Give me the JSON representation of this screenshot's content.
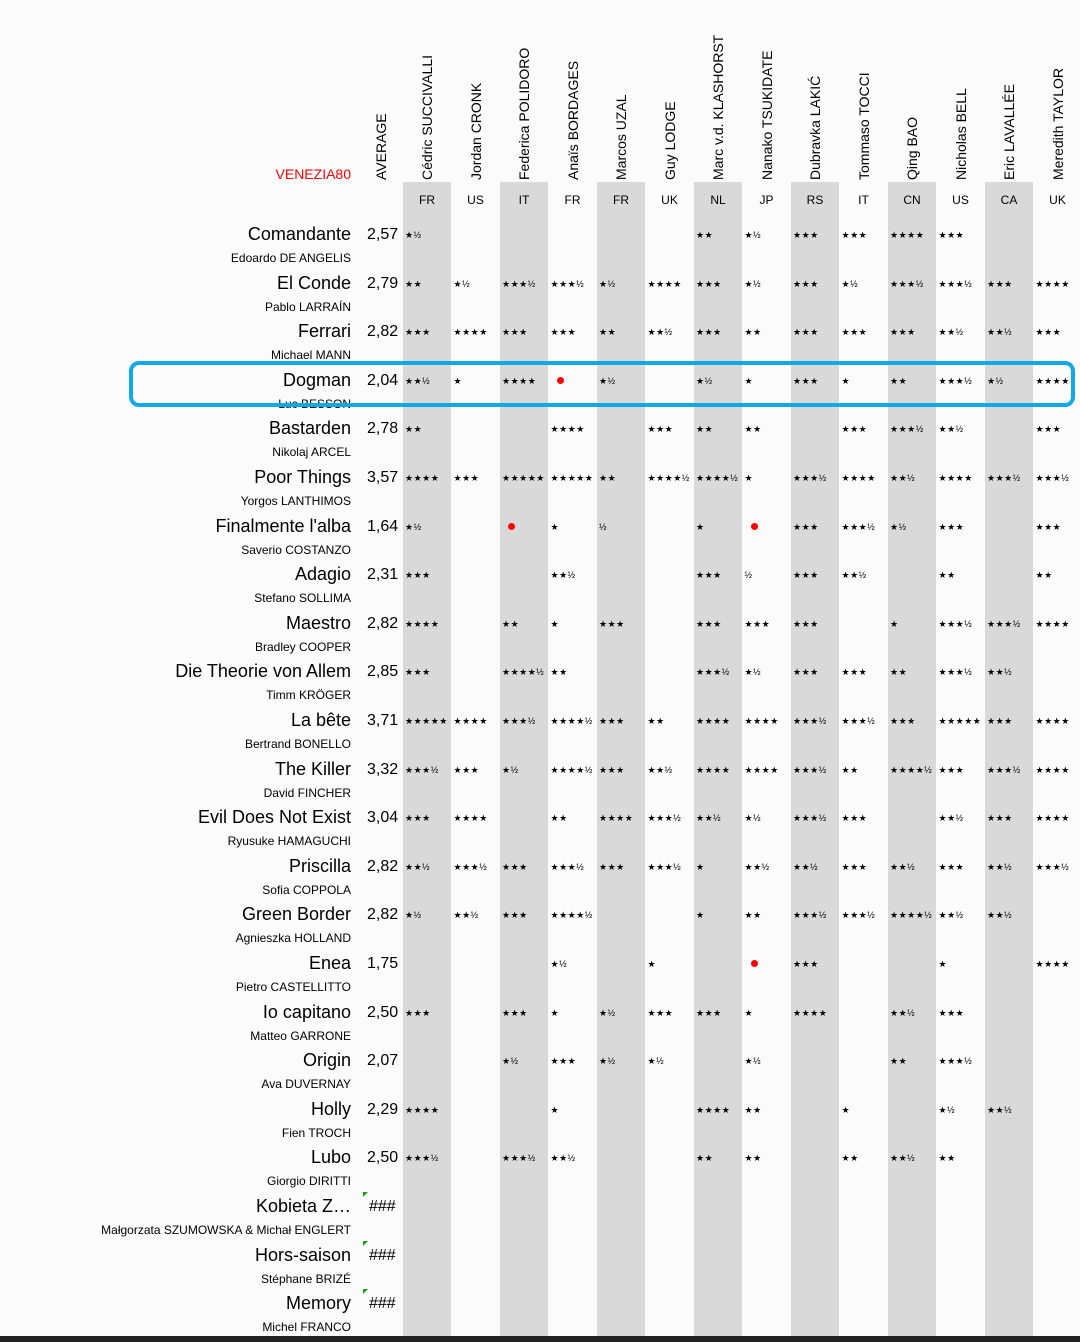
{
  "brand": "VENEZIA80",
  "average_header": "AVERAGE",
  "critics": [
    {
      "name": "Cédric SUCCIVALLI",
      "country": "FR"
    },
    {
      "name": "Jordan CRONK",
      "country": "US"
    },
    {
      "name": "Federica POLIDORO",
      "country": "IT"
    },
    {
      "name": "Anaïs BORDAGES",
      "country": "FR"
    },
    {
      "name": "Marcos UZAL",
      "country": "FR"
    },
    {
      "name": "Guy LODGE",
      "country": "UK"
    },
    {
      "name": "Marc v.d. KLASHORST",
      "country": "NL"
    },
    {
      "name": "Nanako TSUKIDATE",
      "country": "JP"
    },
    {
      "name": "Dubravka LAKIĆ",
      "country": "RS"
    },
    {
      "name": "Tommaso TOCCI",
      "country": "IT"
    },
    {
      "name": "Qing BAO",
      "country": "CN"
    },
    {
      "name": "Nicholas BELL",
      "country": "US"
    },
    {
      "name": "Eric LAVALLÉE",
      "country": "CA"
    },
    {
      "name": "Meredith TAYLOR",
      "country": "UK"
    }
  ],
  "films": [
    {
      "title": "Comandante",
      "director": "Edoardo DE ANGELIS",
      "average": "2,57",
      "ratings": [
        "★½",
        "",
        "",
        "",
        "",
        "",
        "★★",
        "★½",
        "★★★",
        "★★★",
        "★★★★",
        "★★★",
        "",
        ""
      ]
    },
    {
      "title": "El Conde",
      "director": "Pablo LARRAÍN",
      "average": "2,79",
      "ratings": [
        "★★",
        "★½",
        "★★★½",
        "★★★½",
        "★½",
        "★★★★",
        "★★★",
        "★½",
        "★★★",
        "★½",
        "★★★½",
        "★★★½",
        "★★★",
        "★★★★"
      ]
    },
    {
      "title": "Ferrari",
      "director": "Michael MANN",
      "average": "2,82",
      "ratings": [
        "★★★",
        "★★★★",
        "★★★",
        "★★★",
        "★★",
        "★★½",
        "★★★",
        "★★",
        "★★★",
        "★★★",
        "★★★",
        "★★½",
        "★★½",
        "★★★"
      ]
    },
    {
      "title": "Dogman",
      "director": "Luc BESSON",
      "average": "2,04",
      "ratings": [
        "★★½",
        "★",
        "★★★★",
        "•",
        "★½",
        "",
        "★½",
        "★",
        "★★★",
        "★",
        "★★",
        "★★★½",
        "★½",
        "★★★★"
      ]
    },
    {
      "title": "Bastarden",
      "director": "Nikolaj ARCEL",
      "average": "2,78",
      "ratings": [
        "★★",
        "",
        "",
        "★★★★",
        "",
        "★★★",
        "★★",
        "★★",
        "",
        "★★★",
        "★★★½",
        "★★½",
        "",
        "★★★"
      ]
    },
    {
      "title": "Poor Things",
      "director": "Yorgos LANTHIMOS",
      "average": "3,57",
      "ratings": [
        "★★★★",
        "★★★",
        "★★★★★",
        "★★★★★",
        "★★",
        "★★★★½",
        "★★★★½",
        "★",
        "★★★½",
        "★★★★",
        "★★½",
        "★★★★",
        "★★★½",
        "★★★½"
      ]
    },
    {
      "title": "Finalmente l'alba",
      "director": "Saverio COSTANZO",
      "average": "1,64",
      "ratings": [
        "★½",
        "",
        "•",
        "★",
        "½",
        "",
        "★",
        "•",
        "★★★",
        "★★★½",
        "★½",
        "★★★",
        "",
        "★★★"
      ]
    },
    {
      "title": "Adagio",
      "director": "Stefano SOLLIMA",
      "average": "2,31",
      "ratings": [
        "★★★",
        "",
        "",
        "★★½",
        "",
        "",
        "★★★",
        "½",
        "★★★",
        "★★½",
        "",
        "★★",
        "",
        "★★"
      ]
    },
    {
      "title": "Maestro",
      "director": "Bradley COOPER",
      "average": "2,82",
      "ratings": [
        "★★★★",
        "",
        "★★",
        "★",
        "★★★",
        "",
        "★★★",
        "★★★",
        "★★★",
        "",
        "★",
        "★★★½",
        "★★★½",
        "★★★★"
      ]
    },
    {
      "title": "Die Theorie von Allem",
      "director": "Timm KRÖGER",
      "average": "2,85",
      "ratings": [
        "★★★",
        "",
        "★★★★½",
        "★★",
        "",
        "",
        "★★★½",
        "★½",
        "★★★",
        "★★★",
        "★★",
        "★★★½",
        "★★½",
        ""
      ]
    },
    {
      "title": "La bête",
      "director": "Bertrand BONELLO",
      "average": "3,71",
      "ratings": [
        "★★★★★",
        "★★★★",
        "★★★½",
        "★★★★½",
        "★★★",
        "★★",
        "★★★★",
        "★★★★",
        "★★★½",
        "★★★½",
        "★★★",
        "★★★★★",
        "★★★",
        "★★★★"
      ]
    },
    {
      "title": "The Killer",
      "director": "David FINCHER",
      "average": "3,32",
      "ratings": [
        "★★★½",
        "★★★",
        "★½",
        "★★★★½",
        "★★★",
        "★★½",
        "★★★★",
        "★★★★",
        "★★★½",
        "★★",
        "★★★★½",
        "★★★",
        "★★★½",
        "★★★★"
      ]
    },
    {
      "title": "Evil Does Not Exist",
      "director": "Ryusuke HAMAGUCHI",
      "average": "3,04",
      "ratings": [
        "★★★",
        "★★★★",
        "",
        "★★",
        "★★★★",
        "★★★½",
        "★★½",
        "★½",
        "★★★½",
        "★★★",
        "",
        "★★½",
        "★★★",
        "★★★★"
      ]
    },
    {
      "title": "Priscilla",
      "director": "Sofia COPPOLA",
      "average": "2,82",
      "ratings": [
        "★★½",
        "★★★½",
        "★★★",
        "★★★½",
        "★★★",
        "★★★½",
        "★",
        "★★½",
        "★★½",
        "★★★",
        "★★½",
        "★★★",
        "★★½",
        "★★★½"
      ]
    },
    {
      "title": "Green Border",
      "director": "Agnieszka HOLLAND",
      "average": "2,82",
      "ratings": [
        "★½",
        "★★½",
        "★★★",
        "★★★★½",
        "",
        "",
        "★",
        "★★",
        "★★★½",
        "★★★½",
        "★★★★½",
        "★★½",
        "★★½",
        ""
      ]
    },
    {
      "title": "Enea",
      "director": "Pietro CASTELLITTO",
      "average": "1,75",
      "ratings": [
        "",
        "",
        "",
        "★½",
        "",
        "★",
        "",
        "•",
        "★★★",
        "",
        "",
        "★",
        "",
        "★★★★"
      ]
    },
    {
      "title": "Io capitano",
      "director": "Matteo GARRONE",
      "average": "2,50",
      "ratings": [
        "★★★",
        "",
        "★★★",
        "★",
        "★½",
        "★★★",
        "★★★",
        "★",
        "★★★★",
        "",
        "★★½",
        "★★★",
        "",
        ""
      ]
    },
    {
      "title": "Origin",
      "director": "Ava DUVERNAY",
      "average": "2,07",
      "ratings": [
        "",
        "",
        "★½",
        "★★★",
        "★½",
        "★½",
        "",
        "★½",
        "",
        "",
        "★★",
        "★★★½",
        "",
        ""
      ]
    },
    {
      "title": "Holly",
      "director": "Fien TROCH",
      "average": "2,29",
      "ratings": [
        "★★★★",
        "",
        "",
        "★",
        "",
        "",
        "★★★★",
        "★★",
        "",
        "★",
        "",
        "★½",
        "★★½",
        ""
      ]
    },
    {
      "title": "Lubo",
      "director": "Giorgio DIRITTI",
      "average": "2,50",
      "ratings": [
        "★★★½",
        "",
        "★★★½",
        "★★½",
        "",
        "",
        "★★",
        "★★",
        "",
        "★★",
        "★★½",
        "★★",
        "",
        ""
      ]
    },
    {
      "title": "Kobieta Z…",
      "director": "Małgorzata SZUMOWSKA & Michał ENGLERT",
      "average": "###",
      "ratings": [
        "",
        "",
        "",
        "",
        "",
        "",
        "",
        "",
        "",
        "",
        "",
        "",
        "",
        ""
      ]
    },
    {
      "title": "Hors-saison",
      "director": "Stéphane BRIZÉ",
      "average": "###",
      "ratings": [
        "",
        "",
        "",
        "",
        "",
        "",
        "",
        "",
        "",
        "",
        "",
        "",
        "",
        ""
      ]
    },
    {
      "title": "Memory",
      "director": "Michel FRANCO",
      "average": "###",
      "ratings": [
        "",
        "",
        "",
        "",
        "",
        "",
        "",
        "",
        "",
        "",
        "",
        "",
        "",
        ""
      ]
    }
  ],
  "highlighted_film": "Dogman",
  "colors": {
    "highlight": "#10a8e6",
    "accent": "#ff0000",
    "band": "#d9d9d9"
  }
}
